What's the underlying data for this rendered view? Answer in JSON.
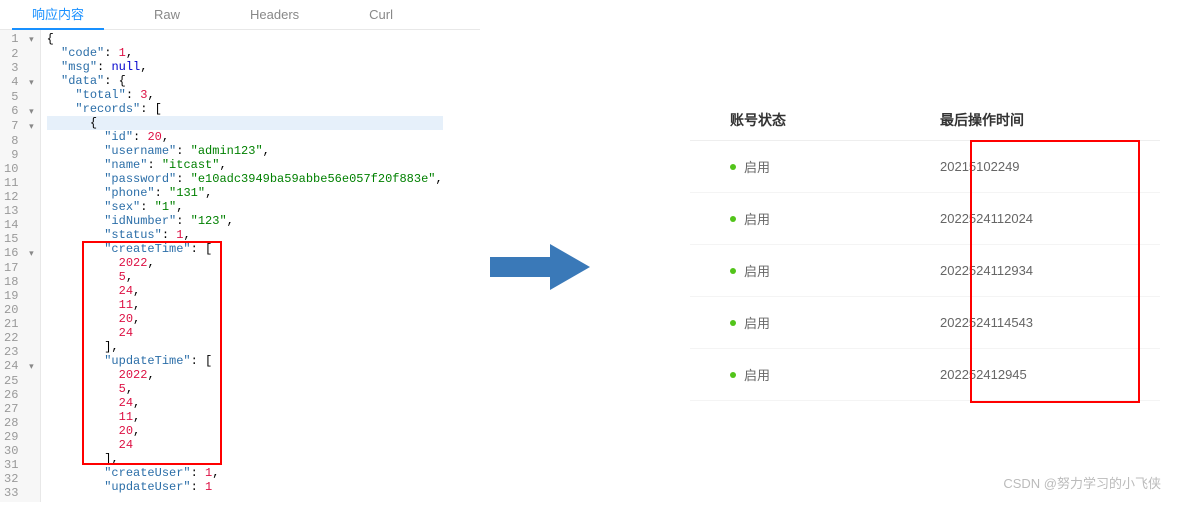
{
  "tabs": [
    {
      "label": "响应内容",
      "active": true
    },
    {
      "label": "Raw",
      "active": false
    },
    {
      "label": "Headers",
      "active": false
    },
    {
      "label": "Curl",
      "active": false
    }
  ],
  "json_response": {
    "lines": [
      {
        "n": 1,
        "fold": "▾",
        "text": "{"
      },
      {
        "n": 2,
        "fold": "",
        "text": "  \"code\": 1,"
      },
      {
        "n": 3,
        "fold": "",
        "text": "  \"msg\": null,"
      },
      {
        "n": 4,
        "fold": "▾",
        "text": "  \"data\": {"
      },
      {
        "n": 5,
        "fold": "",
        "text": "    \"total\": 3,"
      },
      {
        "n": 6,
        "fold": "▾",
        "text": "    \"records\": ["
      },
      {
        "n": 7,
        "fold": "▾",
        "text": "      {",
        "hl": true
      },
      {
        "n": 8,
        "fold": "",
        "text": "        \"id\": 20,"
      },
      {
        "n": 9,
        "fold": "",
        "text": "        \"username\": \"admin123\","
      },
      {
        "n": 10,
        "fold": "",
        "text": "        \"name\": \"itcast\","
      },
      {
        "n": 11,
        "fold": "",
        "text": "        \"password\": \"e10adc3949ba59abbe56e057f20f883e\","
      },
      {
        "n": 12,
        "fold": "",
        "text": "        \"phone\": \"131\","
      },
      {
        "n": 13,
        "fold": "",
        "text": "        \"sex\": \"1\","
      },
      {
        "n": 14,
        "fold": "",
        "text": "        \"idNumber\": \"123\","
      },
      {
        "n": 15,
        "fold": "",
        "text": "        \"status\": 1,"
      },
      {
        "n": 16,
        "fold": "▾",
        "text": "        \"createTime\": ["
      },
      {
        "n": 17,
        "fold": "",
        "text": "          2022,"
      },
      {
        "n": 18,
        "fold": "",
        "text": "          5,"
      },
      {
        "n": 19,
        "fold": "",
        "text": "          24,"
      },
      {
        "n": 20,
        "fold": "",
        "text": "          11,"
      },
      {
        "n": 21,
        "fold": "",
        "text": "          20,"
      },
      {
        "n": 22,
        "fold": "",
        "text": "          24"
      },
      {
        "n": 23,
        "fold": "",
        "text": "        ],"
      },
      {
        "n": 24,
        "fold": "▾",
        "text": "        \"updateTime\": ["
      },
      {
        "n": 25,
        "fold": "",
        "text": "          2022,"
      },
      {
        "n": 26,
        "fold": "",
        "text": "          5,"
      },
      {
        "n": 27,
        "fold": "",
        "text": "          24,"
      },
      {
        "n": 28,
        "fold": "",
        "text": "          11,"
      },
      {
        "n": 29,
        "fold": "",
        "text": "          20,"
      },
      {
        "n": 30,
        "fold": "",
        "text": "          24"
      },
      {
        "n": 31,
        "fold": "",
        "text": "        ],"
      },
      {
        "n": 32,
        "fold": "",
        "text": "        \"createUser\": 1,"
      },
      {
        "n": 33,
        "fold": "",
        "text": "        \"updateUser\": 1"
      }
    ]
  },
  "table": {
    "headers": {
      "status": "账号状态",
      "time": "最后操作时间"
    },
    "status_label": "启用",
    "rows": [
      {
        "time": "20215102249"
      },
      {
        "time": "2022524112024"
      },
      {
        "time": "2022524112934"
      },
      {
        "time": "2022524114543"
      },
      {
        "time": "202252412945"
      }
    ]
  },
  "watermark": "CSDN @努力学习的小飞侠",
  "colors": {
    "arrow": "#3a79b8",
    "red": "#ff0000",
    "tab_active": "#1890ff",
    "dot": "#52c41a"
  }
}
